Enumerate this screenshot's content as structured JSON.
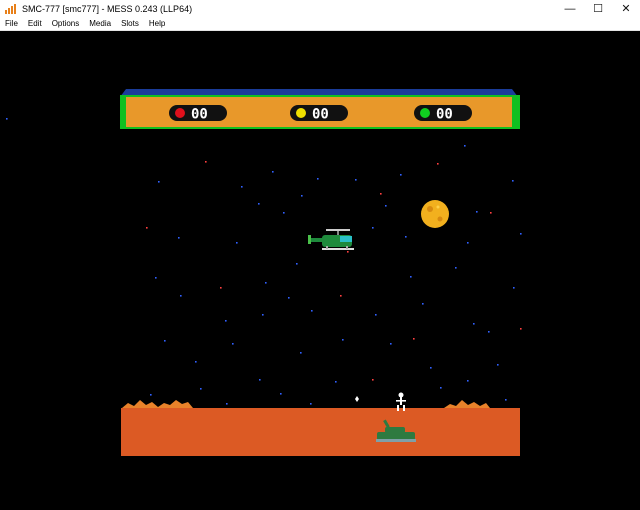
{
  "window": {
    "title": "SMC-777 [smc777] - MESS 0.243 (LLP64)",
    "app_icon": "mame-icon",
    "controls": {
      "minimize": "—",
      "maximize": "☐",
      "close": "✕"
    }
  },
  "menu": {
    "items": [
      {
        "label": "File"
      },
      {
        "label": "Edit"
      },
      {
        "label": "Options"
      },
      {
        "label": "Media"
      },
      {
        "label": "Slots"
      },
      {
        "label": "Help"
      }
    ]
  },
  "game": {
    "hud": {
      "scores": [
        {
          "player": "red",
          "color": "#e0101c",
          "value": "00"
        },
        {
          "player": "yellow",
          "color": "#f0e000",
          "value": "00"
        },
        {
          "player": "green",
          "color": "#10d020",
          "value": "00"
        }
      ]
    },
    "colors": {
      "hud_bar": "#e8982a",
      "hud_border": "#10c020",
      "ground": "#dc5a24",
      "moon": "#f2b01e",
      "helicopter": "#1e8a3c",
      "tank": "#2e7a40",
      "flames": "#e8822a"
    }
  }
}
